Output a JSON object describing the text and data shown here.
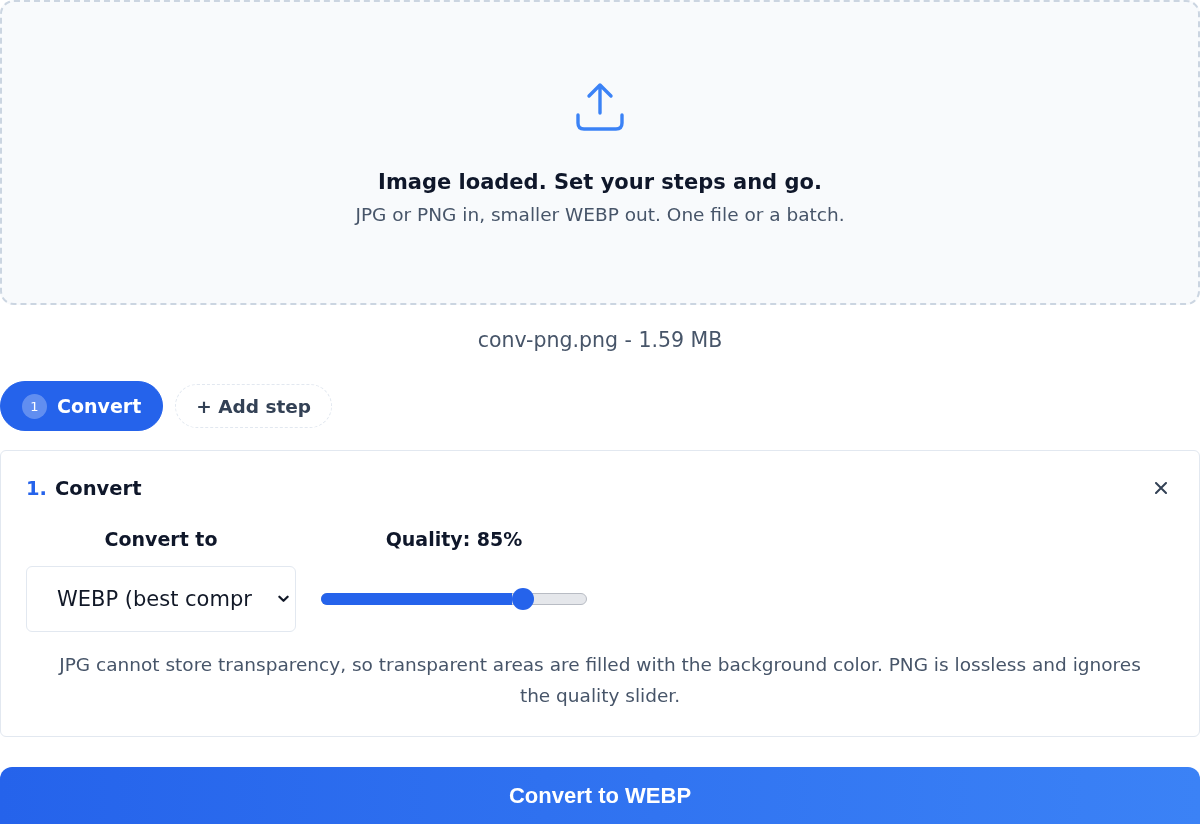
{
  "dropzone": {
    "title": "Image loaded. Set your steps and go.",
    "subtitle": "JPG or PNG in, smaller WEBP out. One file or a batch."
  },
  "file_info": "conv-png.png - 1.59 MB",
  "steps": [
    {
      "number": "1",
      "label": "Convert",
      "selected": true
    }
  ],
  "add_step": "+ Add step",
  "step_card": {
    "number": "1.",
    "title": "Convert",
    "format": {
      "label": "Convert to",
      "value": "WEBP (best compr"
    },
    "quality": {
      "label": "Quality: 85%",
      "level": 0.76
    },
    "note": "JPG cannot store transparency, so transparent areas are filled with the background color. PNG is lossless and ignores the quality slider."
  },
  "primary_button": "Convert to WEBP"
}
